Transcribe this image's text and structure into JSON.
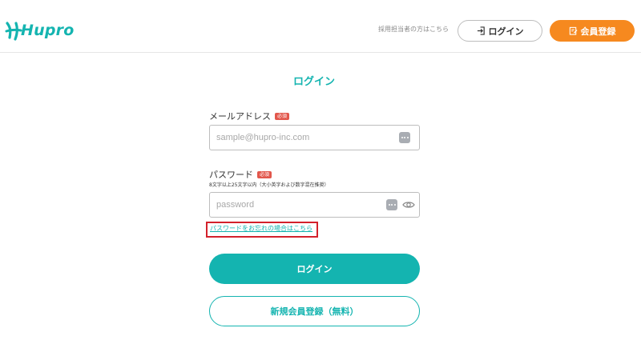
{
  "header": {
    "logo_text": "Hupro",
    "recruiter_link": "採用担当者の方はこちら",
    "login_button": "ログイン",
    "register_button": "会員登録"
  },
  "page": {
    "title": "ログイン"
  },
  "form": {
    "email": {
      "label": "メールアドレス",
      "required_badge": "必須",
      "placeholder": "sample@hupro-inc.com",
      "value": ""
    },
    "password": {
      "label": "パスワード",
      "required_badge": "必須",
      "hint": "8文字以上25文字以内（大小英字および数字混在推奨）",
      "placeholder": "password",
      "value": ""
    },
    "forgot_password_link": "パスワードをお忘れの場合はこちら",
    "login_button": "ログイン",
    "register_button": "新規会員登録（無料）"
  },
  "colors": {
    "brand_teal": "#14b4b0",
    "accent_orange": "#f6891f",
    "required_red": "#e2574c",
    "highlight_red": "#d3212b"
  },
  "icons": {
    "header_login": "login-arrow-icon",
    "header_register": "edit-document-icon",
    "email_autofill": "dots-menu-icon",
    "password_autofill": "dots-menu-icon",
    "password_toggle": "eye-icon"
  }
}
